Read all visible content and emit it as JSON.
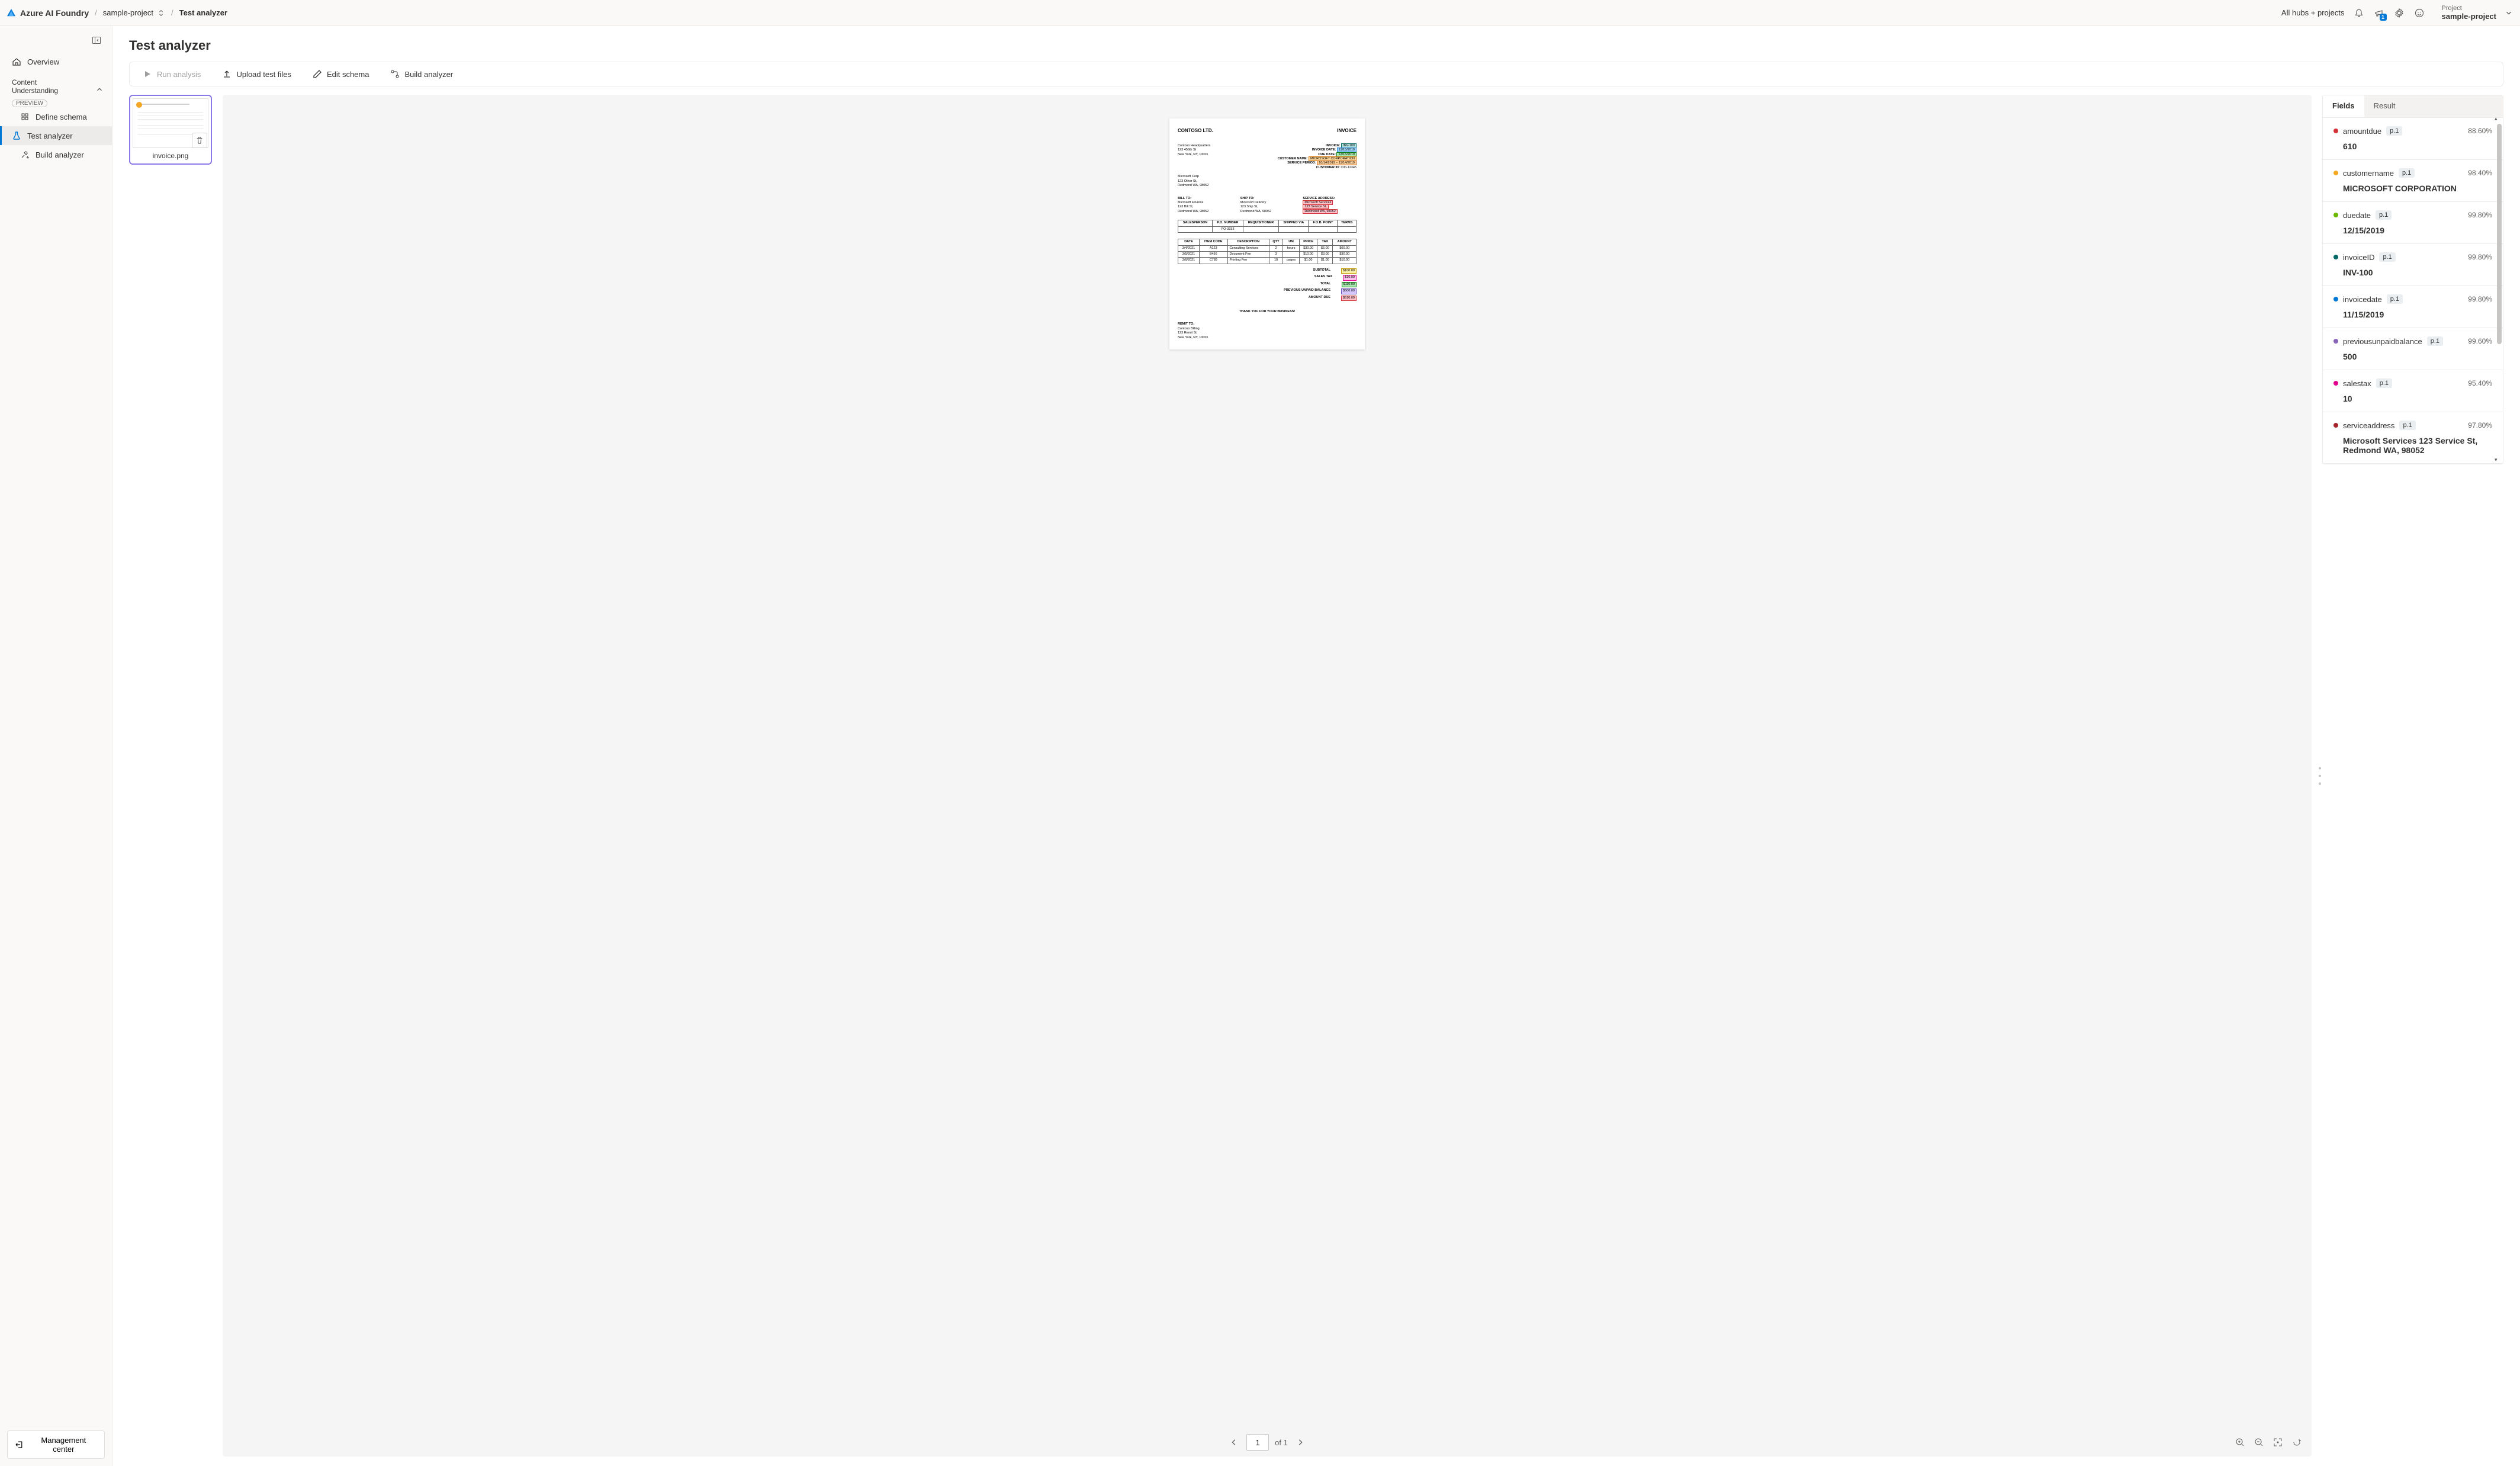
{
  "header": {
    "brand": "Azure AI Foundry",
    "breadcrumb_project": "sample-project",
    "breadcrumb_page": "Test analyzer",
    "all_hubs": "All hubs + projects",
    "notify_badge": "1",
    "project_label": "Project",
    "project_value": "sample-project"
  },
  "sidebar": {
    "overview": "Overview",
    "section_title_1": "Content",
    "section_title_2": "Understanding",
    "preview_tag": "PREVIEW",
    "define_schema": "Define schema",
    "test_analyzer": "Test analyzer",
    "build_analyzer": "Build analyzer",
    "mgmt_center": "Management center"
  },
  "page": {
    "title": "Test analyzer"
  },
  "toolbar": {
    "run": "Run analysis",
    "upload": "Upload test files",
    "edit_schema": "Edit schema",
    "build": "Build analyzer"
  },
  "thumbs": {
    "file1": "invoice.png"
  },
  "invoice": {
    "company": "CONTOSO LTD.",
    "doclabel": "INVOICE",
    "hq1": "Contoso Headquarters",
    "hq2": "123 456th St",
    "hq3": "New York, NY, 10001",
    "inv_no_lbl": "INVOICE:",
    "inv_no": "INV-100",
    "inv_date_lbl": "INVOICE DATE:",
    "inv_date": "11/15/2019",
    "due_date_lbl": "DUE DATE:",
    "due_date": "12/15/2019",
    "cust_name_lbl": "CUSTOMER NAME:",
    "cust_name": "MICROSOFT CORPORATION",
    "svc_period_lbl": "SERVICE PERIOD:",
    "svc_period": "10/14/2019 – 11/14/2019",
    "cust_id_lbl": "CUSTOMER ID:",
    "cust_id": "CID-12345",
    "ms1": "Microsoft Corp",
    "ms2": "123 Other St,",
    "ms3": "Redmond WA, 98052",
    "bill_to_lbl": "BILL TO:",
    "bill1": "Microsoft Finance",
    "bill2": "123 Bill St,",
    "bill3": "Redmond WA, 98052",
    "ship_to_lbl": "SHIP TO:",
    "ship1": "Microsoft Delivery",
    "ship2": "123 Ship St,",
    "ship3": "Redmond WA, 98052",
    "svc_addr_lbl": "SERVICE ADDRESS:",
    "svc1": "Microsoft Services",
    "svc2": "123 Service St,",
    "svc3": "Redmond WA, 98052",
    "t1h1": "SALESPERSON",
    "t1h2": "P.O. NUMBER",
    "t1h3": "REQUISITIONER",
    "t1h4": "SHIPPED VIA",
    "t1h5": "F.O.B. POINT",
    "t1h6": "TERMS",
    "t1r": "PO-3333",
    "t2h1": "DATE",
    "t2h2": "ITEM CODE",
    "t2h3": "DESCRIPTION",
    "t2h4": "QTY",
    "t2h5": "UM",
    "t2h6": "PRICE",
    "t2h7": "TAX",
    "t2h8": "AMOUNT",
    "r1": {
      "d": "3/4/2021",
      "c": "A123",
      "desc": "Consulting Services",
      "q": "2",
      "u": "hours",
      "p": "$30.00",
      "t": "$6.00",
      "a": "$60.00"
    },
    "r2": {
      "d": "3/5/2021",
      "c": "B456",
      "desc": "Document Fee",
      "q": "3",
      "u": "",
      "p": "$10.00",
      "t": "$3.00",
      "a": "$30.00"
    },
    "r3": {
      "d": "3/6/2021",
      "c": "C789",
      "desc": "Printing Fee",
      "q": "10",
      "u": "pages",
      "p": "$1.00",
      "t": "$1.00",
      "a": "$10.00"
    },
    "subtotal_lbl": "SUBTOTAL",
    "subtotal": "$100.00",
    "salestax_lbl": "SALES TAX",
    "salestax": "$10.00",
    "total_lbl": "TOTAL",
    "total": "$110.00",
    "prev_lbl": "PREVIOUS UNPAID BALANCE",
    "prev": "$500.00",
    "amtdue_lbl": "AMOUNT DUE",
    "amtdue": "$610.00",
    "thanks": "THANK YOU FOR YOUR BUSINESS!",
    "remit_lbl": "REMIT TO:",
    "remit1": "Contoso Billing",
    "remit2": "123 Remit St",
    "remit3": "New York, NY, 10001"
  },
  "pager": {
    "current": "1",
    "of_label": "of 1"
  },
  "results": {
    "tab_fields": "Fields",
    "tab_result": "Result",
    "fields": [
      {
        "name": "amountdue",
        "page": "p.1",
        "conf": "88.60%",
        "value": "610",
        "color": "#d13438"
      },
      {
        "name": "customername",
        "page": "p.1",
        "conf": "98.40%",
        "value": "MICROSOFT CORPORATION",
        "color": "#f5a623"
      },
      {
        "name": "duedate",
        "page": "p.1",
        "conf": "99.80%",
        "value": "12/15/2019",
        "color": "#6bb700"
      },
      {
        "name": "invoiceID",
        "page": "p.1",
        "conf": "99.80%",
        "value": "INV-100",
        "color": "#006666"
      },
      {
        "name": "invoicedate",
        "page": "p.1",
        "conf": "99.80%",
        "value": "11/15/2019",
        "color": "#0078d4"
      },
      {
        "name": "previousunpaidbalance",
        "page": "p.1",
        "conf": "99.60%",
        "value": "500",
        "color": "#8764b8"
      },
      {
        "name": "salestax",
        "page": "p.1",
        "conf": "95.40%",
        "value": "10",
        "color": "#e3008c"
      },
      {
        "name": "serviceaddress",
        "page": "p.1",
        "conf": "97.80%",
        "value": "Microsoft Services 123 Service St, Redmond WA, 98052",
        "color": "#a4262c"
      }
    ]
  }
}
